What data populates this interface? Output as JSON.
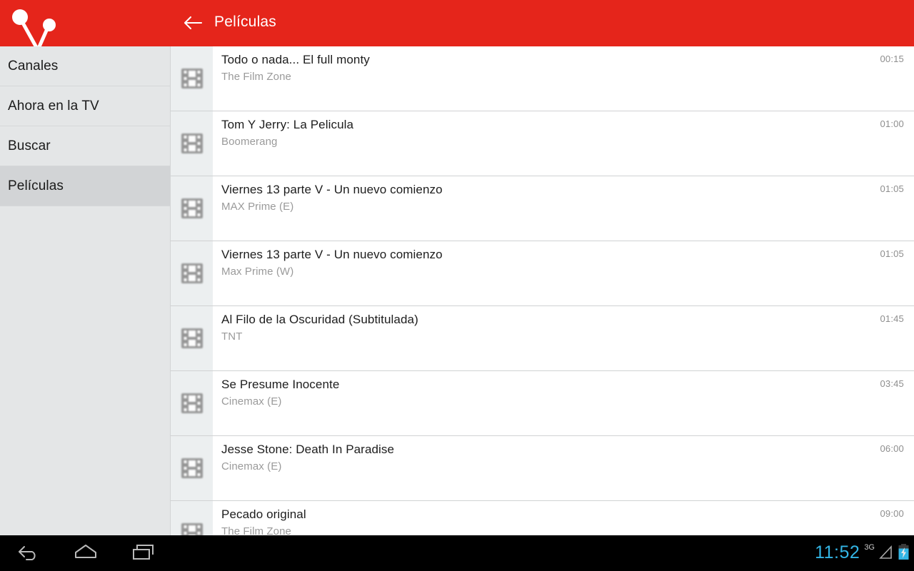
{
  "app": {
    "brand_red": "#e5251b",
    "logo_icon": "v-antenna-logo-icon"
  },
  "appbar": {
    "title": "Películas",
    "back_icon": "arrow-left-icon"
  },
  "sidebar": {
    "items": [
      {
        "label": "Canales",
        "selected": false
      },
      {
        "label": "Ahora en la TV",
        "selected": false
      },
      {
        "label": "Buscar",
        "selected": false
      },
      {
        "label": "Películas",
        "selected": true
      }
    ]
  },
  "list": {
    "item_icon": "filmstrip-icon",
    "rows": [
      {
        "title": "Todo o nada... El full monty",
        "channel": "The Film Zone",
        "time": "00:15"
      },
      {
        "title": "Tom Y Jerry: La Pelicula",
        "channel": "Boomerang",
        "time": "01:00"
      },
      {
        "title": "Viernes 13 parte V - Un nuevo comienzo",
        "channel": "MAX Prime (E)",
        "time": "01:05"
      },
      {
        "title": "Viernes 13 parte V - Un nuevo comienzo",
        "channel": "Max Prime (W)",
        "time": "01:05"
      },
      {
        "title": "Al Filo de la Oscuridad (Subtitulada)",
        "channel": "TNT",
        "time": "01:45"
      },
      {
        "title": "Se Presume Inocente",
        "channel": "Cinemax (E)",
        "time": "03:45"
      },
      {
        "title": "Jesse Stone: Death In Paradise",
        "channel": "Cinemax (E)",
        "time": "06:00"
      },
      {
        "title": "Pecado original",
        "channel": "The Film Zone",
        "time": "09:00"
      }
    ]
  },
  "navbar": {
    "back_icon": "android-back-icon",
    "home_icon": "android-home-icon",
    "recents_icon": "android-recents-icon"
  },
  "statusbar": {
    "clock": "11:52",
    "clock_color": "#33b5e5",
    "network": "3G",
    "signal_icon": "signal-triangle-icon",
    "battery_icon": "battery-charging-icon"
  }
}
